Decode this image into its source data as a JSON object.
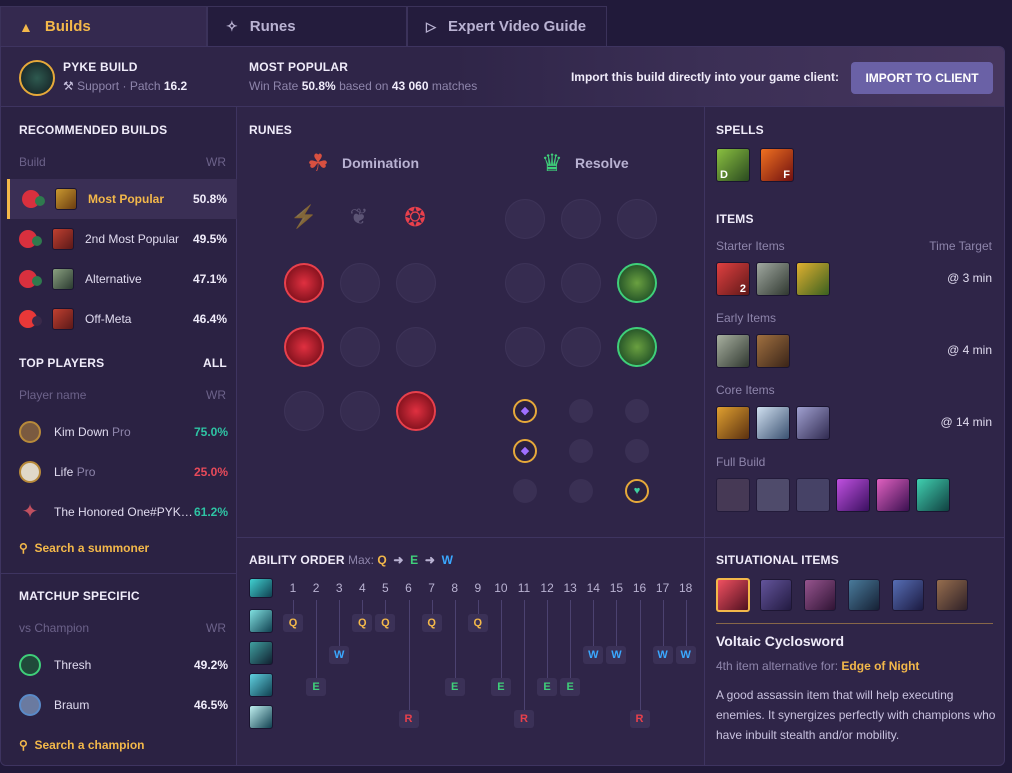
{
  "tabs": [
    {
      "label": "Builds"
    },
    {
      "label": "Runes"
    },
    {
      "label": "Expert Video Guide"
    }
  ],
  "header": {
    "champ_title": "PYKE BUILD",
    "role": "Support",
    "patch_label": "Patch",
    "patch": "16.2",
    "most_popular": "MOST POPULAR",
    "win_rate_label": "Win Rate",
    "win_rate": "50.8%",
    "based_on": "based on",
    "matches": "43 060",
    "matches_suffix": "matches",
    "import_text": "Import this build directly into your game client:",
    "import_button": "IMPORT TO CLIENT"
  },
  "recommended": {
    "title": "RECOMMENDED BUILDS",
    "col_build": "Build",
    "col_wr": "WR",
    "rows": [
      {
        "label": "Most Popular",
        "wr": "50.8%"
      },
      {
        "label": "2nd Most Popular",
        "wr": "49.5%"
      },
      {
        "label": "Alternative",
        "wr": "47.1%"
      },
      {
        "label": "Off-Meta",
        "wr": "46.4%"
      }
    ]
  },
  "top_players": {
    "title": "TOP PLAYERS",
    "all": "ALL",
    "col_name": "Player name",
    "col_wr": "WR",
    "rows": [
      {
        "name": "Kim Down",
        "tag": "Pro",
        "wr": "75.0%",
        "color": "#2ec4a4"
      },
      {
        "name": "Life",
        "tag": "Pro",
        "wr": "25.0%",
        "color": "#e84a5a"
      },
      {
        "name": "The Honored One#PYK…",
        "tag": "",
        "wr": "61.2%",
        "color": "#2ec4a4"
      }
    ],
    "search": "Search a summoner"
  },
  "matchup": {
    "title": "MATCHUP SPECIFIC",
    "col_name": "vs Champion",
    "col_wr": "WR",
    "rows": [
      {
        "name": "Thresh",
        "wr": "49.2%"
      },
      {
        "name": "Braum",
        "wr": "46.5%"
      }
    ],
    "search": "Search a champion"
  },
  "runes": {
    "title": "RUNES",
    "primary": "Domination",
    "secondary": "Resolve"
  },
  "spells": {
    "title": "SPELLS",
    "keys": [
      "D",
      "F"
    ]
  },
  "items": {
    "title": "ITEMS",
    "starter": "Starter Items",
    "time_target": "Time Target",
    "starter_time": "@ 3 min",
    "starter_count": "2",
    "early": "Early Items",
    "early_time": "@ 4 min",
    "core": "Core Items",
    "core_time": "@ 14 min",
    "full": "Full Build"
  },
  "ability": {
    "title": "ABILITY ORDER",
    "max_label": "Max:",
    "max": [
      "Q",
      "E",
      "W"
    ],
    "levels": [
      "1",
      "2",
      "3",
      "4",
      "5",
      "6",
      "7",
      "8",
      "9",
      "10",
      "11",
      "12",
      "13",
      "14",
      "15",
      "16",
      "17",
      "18"
    ]
  },
  "situational": {
    "title": "SITUATIONAL ITEMS",
    "item_name": "Voltaic Cyclosword",
    "alt_label": "4th item alternative for:",
    "alt_item": "Edge of Night",
    "description": "A good assassin item that will help executing enemies. It synergizes perfectly with champions who have inbuilt stealth and/or mobility."
  },
  "colors": {
    "accent": "#f3b84a",
    "q": "#f3b84a",
    "w": "#3aa8ff",
    "e": "#3fcf7a",
    "r": "#e8404c"
  }
}
